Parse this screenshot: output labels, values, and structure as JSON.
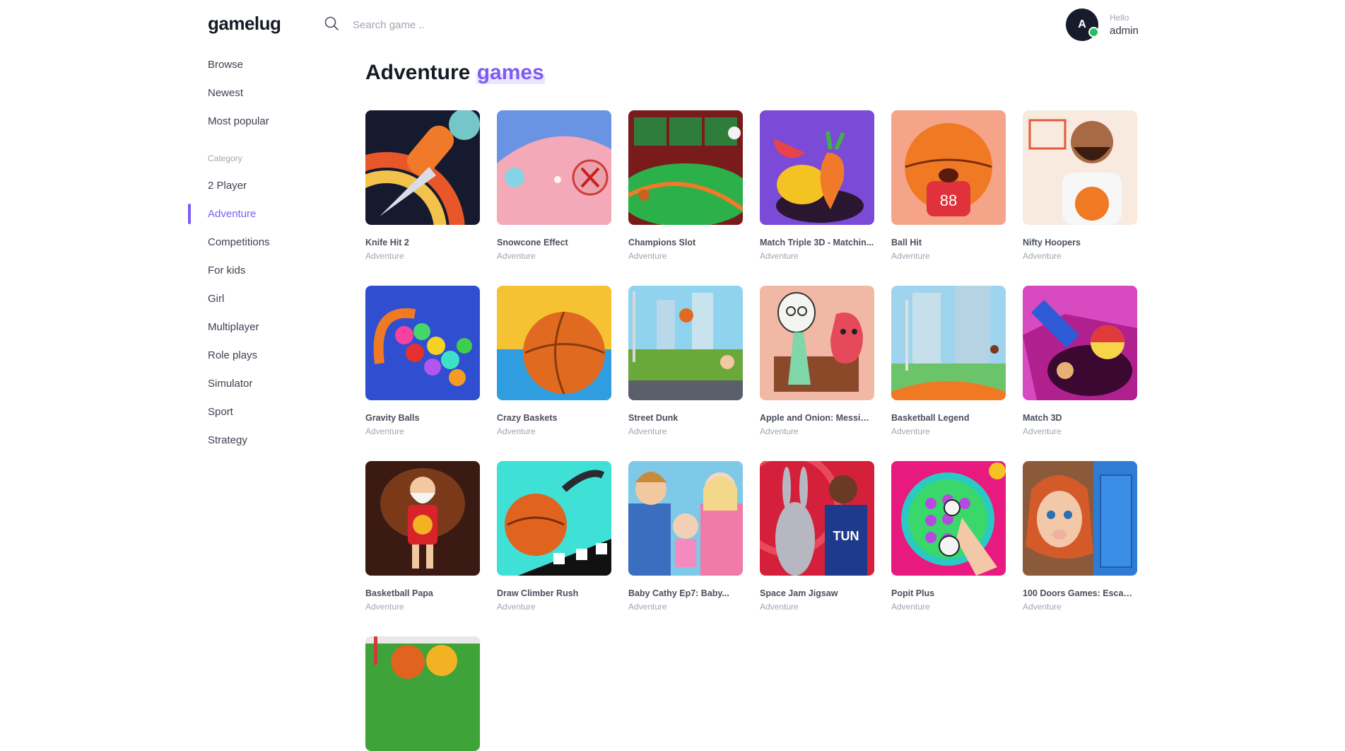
{
  "header": {
    "logo": "gamelug",
    "search_placeholder": "Search game ..",
    "user_initial": "A",
    "greeting": "Hello",
    "username": "admin"
  },
  "sidebar": {
    "main": [
      "Browse",
      "Newest",
      "Most popular"
    ],
    "category_label": "Category",
    "categories": [
      "2 Player",
      "Adventure",
      "Competitions",
      "For kids",
      "Girl",
      "Multiplayer",
      "Role plays",
      "Simulator",
      "Sport",
      "Strategy"
    ],
    "active": "Adventure"
  },
  "page": {
    "title_word": "Adventure",
    "title_accent": "games"
  },
  "colors": {
    "accent": "#7c5cf5",
    "online": "#22c05a",
    "avatar_bg": "#161c2b"
  },
  "games": [
    {
      "name": "Knife Hit 2",
      "category": "Adventure"
    },
    {
      "name": "Snowcone Effect",
      "category": "Adventure"
    },
    {
      "name": "Champions Slot",
      "category": "Adventure"
    },
    {
      "name": "Match Triple 3D - Matchin...",
      "category": "Adventure"
    },
    {
      "name": "Ball Hit",
      "category": "Adventure"
    },
    {
      "name": "Nifty Hoopers",
      "category": "Adventure"
    },
    {
      "name": "Gravity Balls",
      "category": "Adventure"
    },
    {
      "name": "Crazy Baskets",
      "category": "Adventure"
    },
    {
      "name": "Street Dunk",
      "category": "Adventure"
    },
    {
      "name": "Apple and Onion: Messin'...",
      "category": "Adventure"
    },
    {
      "name": "Basketball Legend",
      "category": "Adventure"
    },
    {
      "name": "Match 3D",
      "category": "Adventure"
    },
    {
      "name": "Basketball Papa",
      "category": "Adventure"
    },
    {
      "name": "Draw Climber Rush",
      "category": "Adventure"
    },
    {
      "name": "Baby Cathy Ep7: Baby...",
      "category": "Adventure"
    },
    {
      "name": "Space Jam Jigsaw",
      "category": "Adventure"
    },
    {
      "name": "Popit Plus",
      "category": "Adventure"
    },
    {
      "name": "100 Doors Games: Escape...",
      "category": "Adventure"
    }
  ]
}
